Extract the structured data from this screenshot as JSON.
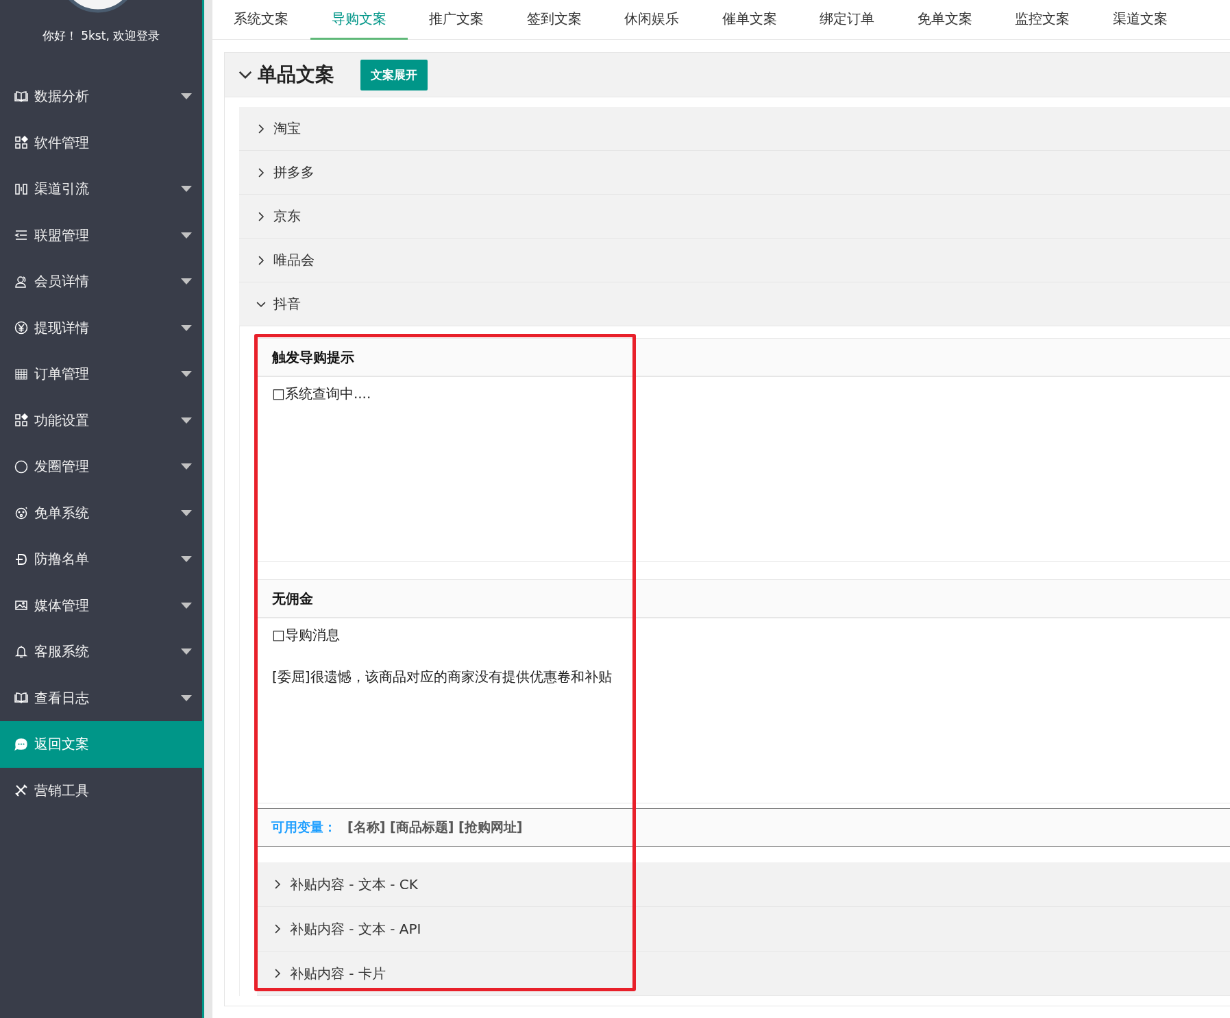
{
  "sidebar": {
    "greeting": "你好！ 5kst, 欢迎登录",
    "items": [
      {
        "label": "数据分析",
        "has_submenu": true,
        "selected": false
      },
      {
        "label": "软件管理",
        "has_submenu": false,
        "selected": false
      },
      {
        "label": "渠道引流",
        "has_submenu": true,
        "selected": false
      },
      {
        "label": "联盟管理",
        "has_submenu": true,
        "selected": false
      },
      {
        "label": "会员详情",
        "has_submenu": true,
        "selected": false
      },
      {
        "label": "提现详情",
        "has_submenu": true,
        "selected": false
      },
      {
        "label": "订单管理",
        "has_submenu": true,
        "selected": false
      },
      {
        "label": "功能设置",
        "has_submenu": true,
        "selected": false
      },
      {
        "label": "发圈管理",
        "has_submenu": true,
        "selected": false
      },
      {
        "label": "免单系统",
        "has_submenu": true,
        "selected": false
      },
      {
        "label": "防撸名单",
        "has_submenu": true,
        "selected": false
      },
      {
        "label": "媒体管理",
        "has_submenu": true,
        "selected": false
      },
      {
        "label": "客服系统",
        "has_submenu": true,
        "selected": false
      },
      {
        "label": "查看日志",
        "has_submenu": true,
        "selected": false
      },
      {
        "label": "返回文案",
        "has_submenu": false,
        "selected": true
      },
      {
        "label": "营销工具",
        "has_submenu": false,
        "selected": false
      }
    ]
  },
  "tabs": [
    {
      "label": "系统文案",
      "selected": false
    },
    {
      "label": "导购文案",
      "selected": true
    },
    {
      "label": "推广文案",
      "selected": false
    },
    {
      "label": "签到文案",
      "selected": false
    },
    {
      "label": "休闲娱乐",
      "selected": false
    },
    {
      "label": "催单文案",
      "selected": false
    },
    {
      "label": "绑定订单",
      "selected": false
    },
    {
      "label": "免单文案",
      "selected": false
    },
    {
      "label": "监控文案",
      "selected": false
    },
    {
      "label": "渠道文案",
      "selected": false
    }
  ],
  "panel": {
    "title": "单品文案",
    "expanded": true,
    "button": "文案展开",
    "platforms": [
      {
        "label": "淘宝",
        "expanded": false
      },
      {
        "label": "拼多多",
        "expanded": false
      },
      {
        "label": "京东",
        "expanded": false
      },
      {
        "label": "唯品会",
        "expanded": false
      },
      {
        "label": "抖音",
        "expanded": true
      }
    ],
    "cards": [
      {
        "title": "触发导购提示",
        "lines": [
          "□系统查询中...."
        ]
      },
      {
        "title": "无佣金",
        "lines": [
          "□导购消息",
          "[委屈]很遗憾，该商品对应的商家没有提供优惠卷和补贴"
        ]
      }
    ],
    "variables": {
      "label": "可用变量：",
      "values": "[名称] [商品标题] [抢购网址]"
    },
    "sub_sections": [
      {
        "label": "补贴内容 - 文本 - CK",
        "expanded": false
      },
      {
        "label": "补贴内容 - 文本 - API",
        "expanded": false
      },
      {
        "label": "补贴内容 - 卡片",
        "expanded": false
      }
    ]
  }
}
